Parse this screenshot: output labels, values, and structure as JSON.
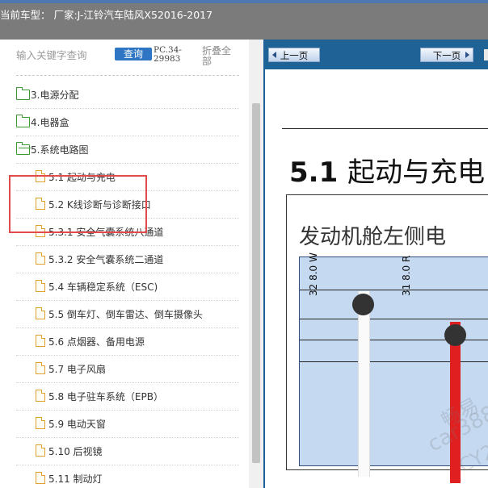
{
  "header": {
    "vehicle_info": "当前车型： 厂家:J-江铃汽车陆风X52016-2017"
  },
  "search": {
    "placeholder": "输入关键字查询",
    "query_label": "查询",
    "doc_code": "PC.34-29983",
    "collapse_all_label": "折叠全部"
  },
  "tree": {
    "folders": [
      {
        "label": "3.电源分配"
      },
      {
        "label": "4.电器盒"
      },
      {
        "label": "5.系统电路图"
      }
    ],
    "items": [
      {
        "label": "5.1 起动与充电"
      },
      {
        "label": "5.2 K线诊断与诊断接口"
      },
      {
        "label": "5.3.1 安全气囊系统八通道"
      },
      {
        "label": "5.3.2 安全气囊系统二通道"
      },
      {
        "label": "5.4 车辆稳定系统（ESC)"
      },
      {
        "label": "5.5 倒车灯、倒车雷达、倒车摄像头"
      },
      {
        "label": "5.6 点烟器、备用电源"
      },
      {
        "label": "5.7 电子风扇"
      },
      {
        "label": "5.8 电子驻车系统（EPB）"
      },
      {
        "label": "5.9 电动天窗"
      },
      {
        "label": "5.10 后视镜"
      },
      {
        "label": "5.11 制动灯"
      }
    ]
  },
  "viewer": {
    "prev_label": "上一页",
    "next_label": "下一页",
    "section_number": "5.1",
    "section_name": "起动与充电",
    "diagram_title": "发动机舱左侧电",
    "wire_label_1": "32 8.0 W",
    "wire_label_2": "31 8.0 R",
    "watermark_1": "畅易",
    "watermark_2": "car388.",
    "watermark_3": "CY20",
    "colors": {
      "accent_blue": "#1f6296",
      "highlight_red": "#e14b4b",
      "folder_green": "#3a9b2e",
      "file_orange": "#e0a030",
      "wire_red": "#e02020",
      "diagram_bg": "#c5d9f1"
    }
  }
}
